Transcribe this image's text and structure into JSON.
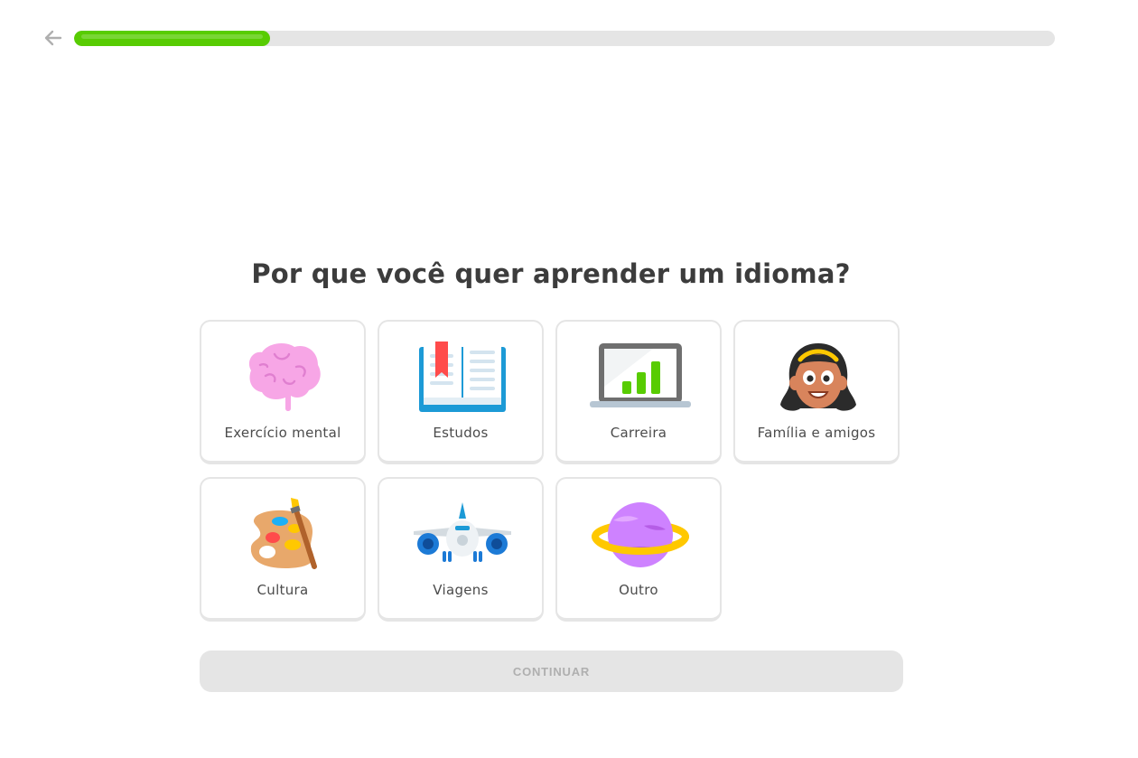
{
  "progress": {
    "value": 0.2
  },
  "question": {
    "title": "Por que você quer aprender um idioma?"
  },
  "options": [
    {
      "label": "Exercício mental",
      "icon": "brain-icon"
    },
    {
      "label": "Estudos",
      "icon": "book-icon"
    },
    {
      "label": "Carreira",
      "icon": "laptop-chart-icon"
    },
    {
      "label": "Família e amigos",
      "icon": "woman-icon"
    },
    {
      "label": "Cultura",
      "icon": "palette-icon"
    },
    {
      "label": "Viagens",
      "icon": "airplane-icon"
    },
    {
      "label": "Outro",
      "icon": "planet-icon"
    }
  ],
  "footer": {
    "continue_label": "CONTINUAR"
  },
  "colors": {
    "accent_green": "#58cc02",
    "track_gray": "#e5e5e5",
    "text_dark": "#3c3c3c",
    "disabled_text": "#afafaf"
  }
}
